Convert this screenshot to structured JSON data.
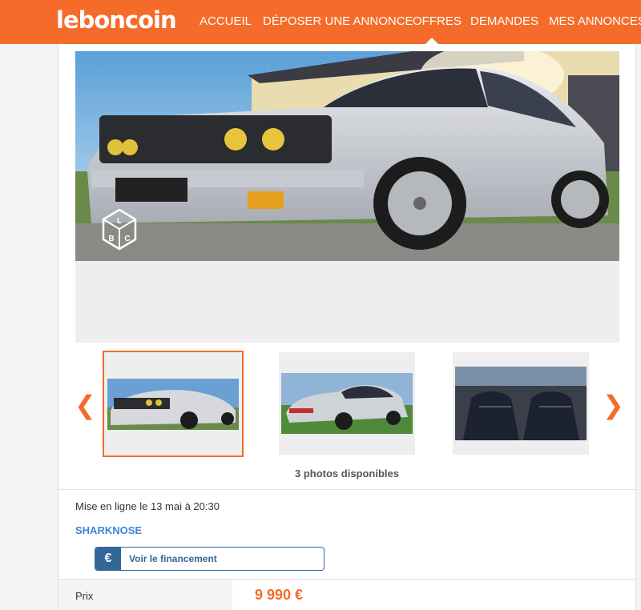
{
  "header": {
    "logo": "leboncoin",
    "nav": [
      {
        "label": "ACCUEIL"
      },
      {
        "label": "DÉPOSER UNE ANNONCE"
      },
      {
        "label": "OFFRES"
      },
      {
        "label": "DEMANDES"
      },
      {
        "label": "MES ANNONCES"
      }
    ],
    "active_nav": "OFFRES"
  },
  "gallery": {
    "watermark_letters": [
      "L",
      "B",
      "C"
    ],
    "prev_icon": "chevron-left-icon",
    "next_icon": "chevron-right-icon",
    "photo_count": "3 photos disponibles"
  },
  "ad": {
    "posted": "Mise en ligne le 13 mai à 20:30",
    "seller": "SHARKNOSE",
    "finance_icon": "€",
    "finance_label": "Voir le financement",
    "price_label": "Prix",
    "price_value": "9 990 €"
  },
  "colors": {
    "brand": "#f56b2a",
    "link": "#4183d7",
    "finance": "#336699"
  }
}
